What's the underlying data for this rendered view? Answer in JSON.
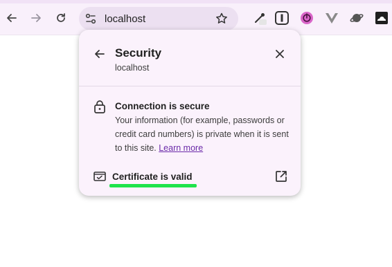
{
  "browser": {
    "address_text": "localhost",
    "icons": {
      "back": "arrow-left-icon",
      "forward": "arrow-right-icon",
      "reload": "reload-icon",
      "site_info": "tune-icon",
      "bookmark": "star-icon"
    },
    "extensions": [
      "eyedropper-icon",
      "instapaper-icon",
      "power-icon",
      "vue-devtools-icon",
      "planet-icon",
      "cloud-icon"
    ]
  },
  "security_panel": {
    "title": "Security",
    "subtitle": "localhost",
    "connection_title": "Connection is secure",
    "connection_desc": "Your information (for example, passwords or credit card numbers) is private when it is sent to this site.",
    "learn_more": "Learn more",
    "certificate_label": "Certificate is valid"
  },
  "colors": {
    "toolbar_bg": "#f9f0fb",
    "omnibox_bg": "#ece0f1",
    "panel_bg": "#fbf2fc",
    "link": "#6a29a8",
    "highlight": "#1ee34b"
  }
}
